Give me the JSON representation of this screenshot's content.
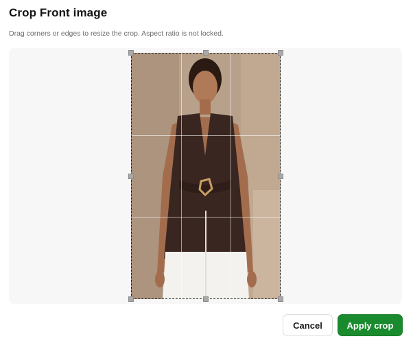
{
  "dialog": {
    "title": "Crop Front image",
    "subtitle": "Drag corners or edges to resize the crop. Aspect ratio is not locked."
  },
  "actions": {
    "cancel_label": "Cancel",
    "apply_label": "Apply crop"
  },
  "colors": {
    "accent": "#1a8a2e",
    "stage_background": "#f7f7f7",
    "photo_background": "#b39d86"
  },
  "icons": {
    "crop_handles": "square-handle"
  }
}
